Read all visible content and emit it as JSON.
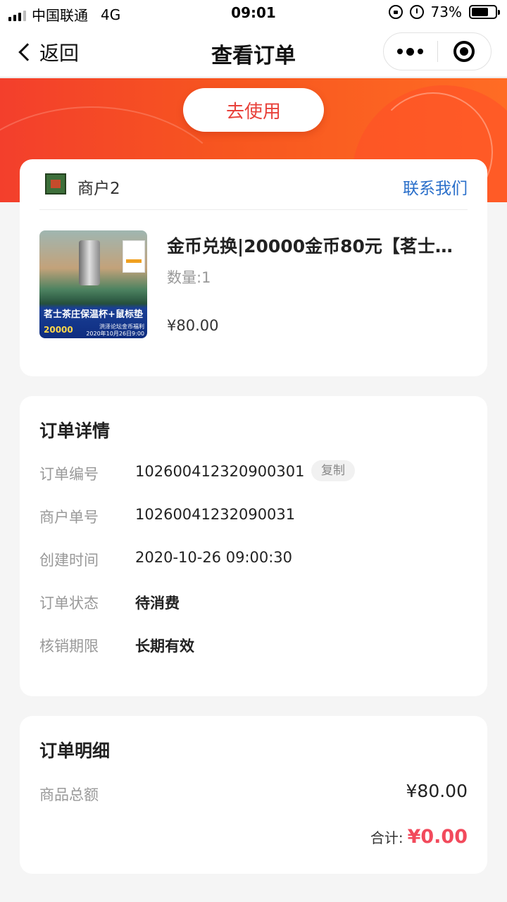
{
  "status_bar": {
    "carrier": "中国联通",
    "network": "4G",
    "time": "09:01",
    "battery": "73%",
    "battery_level": 0.73,
    "icons": [
      "signal-icon",
      "lock-rotation-icon",
      "alarm-icon",
      "battery-icon"
    ]
  },
  "nav": {
    "back_label": "返回",
    "title": "查看订单",
    "icons": [
      "chevron-left-icon",
      "more-icon",
      "close-target-icon"
    ]
  },
  "banner": {
    "use_button": "去使用"
  },
  "merchant": {
    "name": "商户2",
    "contact": "联系我们"
  },
  "product": {
    "title": "金币兑换|20000金币80元【茗士…",
    "quantity": "数量:1",
    "price": "¥80.00",
    "thumb_title": "茗士茶庄保温杯+鼠标垫",
    "thumb_price": "20000",
    "thumb_sub_1": "洪泽论坛金币福利",
    "thumb_sub_2": "2020年10月26日9:00"
  },
  "detail": {
    "section_title": "订单详情",
    "rows": [
      {
        "label": "订单编号",
        "value": "102600412320900301"
      },
      {
        "label": "商户单号",
        "value": "10260041232090031"
      },
      {
        "label": "创建时间",
        "value": "2020-10-26 09:00:30"
      },
      {
        "label": "订单状态",
        "value": "待消费"
      },
      {
        "label": "核销期限",
        "value": "长期有效"
      }
    ],
    "copy_label": "复制"
  },
  "summary": {
    "section_title": "订单明细",
    "goods_total_label": "商品总额",
    "goods_total_value": "¥80.00",
    "total_label": "合计:",
    "total_value": "¥0.00"
  },
  "colors": {
    "accent_red": "#f24a5c",
    "banner_orange": "#f7561f",
    "link_blue": "#2a6fca"
  }
}
